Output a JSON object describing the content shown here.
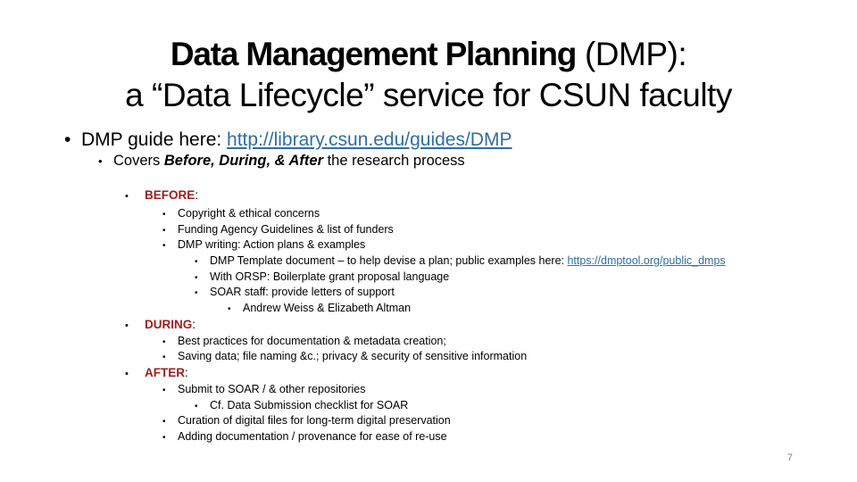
{
  "slide": {
    "title_bold": "Data Management Planning",
    "title_rest": " (DMP):",
    "subtitle": "a “Data Lifecycle” service for CSUN faculty",
    "guide": {
      "label": "DMP guide here: ",
      "link_text": "http://library.csun.edu/guides/DMP"
    },
    "covers": {
      "prefix": "Covers ",
      "emphasis": "Before, During, & After",
      "suffix": " the research process"
    },
    "before": {
      "heading": "BEFORE",
      "colon": ":",
      "items": [
        "Copyright & ethical concerns",
        "Funding Agency Guidelines & list of funders",
        "DMP writing: Action plans & examples"
      ],
      "sub_items": {
        "template_text": "DMP Template document – to help devise a plan; public examples here: ",
        "template_link": "https://dmptool.org/public_dmps",
        "orsp": "With ORSP: Boilerplate grant proposal language",
        "soar": "SOAR staff: provide letters of support",
        "staff": "Andrew Weiss & Elizabeth Altman"
      }
    },
    "during": {
      "heading": "DURING",
      "colon": ":",
      "items": [
        "Best practices for documentation & metadata creation;",
        "Saving data; file naming &c.; privacy & security of sensitive information"
      ]
    },
    "after": {
      "heading": "AFTER",
      "colon": ":",
      "items": [
        "Submit to SOAR / & other repositories",
        "Cf. Data Submission checklist for SOAR",
        "Curation of digital files for long-term digital preservation",
        "Adding documentation / provenance for ease of re-use"
      ]
    },
    "bullet_char": "•",
    "page_number": "7",
    "colors": {
      "heading_red": "#a01c1c",
      "link_blue": "#2e6ea6",
      "page_number_gray": "#7f7f7f"
    }
  }
}
